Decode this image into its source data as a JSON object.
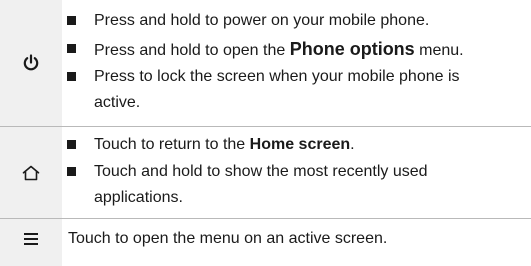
{
  "keys": [
    {
      "icon": "power-icon",
      "bullets": [
        {
          "before": "Press and hold to power on your mobile phone.",
          "bold": "",
          "after": ""
        },
        {
          "before": "Press and hold to open the ",
          "bold": "Phone options",
          "after": " menu."
        },
        {
          "before": "Press to lock the screen when your mobile phone is active.",
          "bold": "",
          "after": ""
        }
      ]
    },
    {
      "icon": "home-icon",
      "bullets": [
        {
          "before": "Touch to return to the ",
          "bold": "Home screen",
          "after": "."
        },
        {
          "before": "Touch and hold to show the most recently used applications.",
          "bold": "",
          "after": ""
        }
      ]
    },
    {
      "icon": "menu-icon",
      "text": "Touch to open the menu on an active screen."
    }
  ]
}
